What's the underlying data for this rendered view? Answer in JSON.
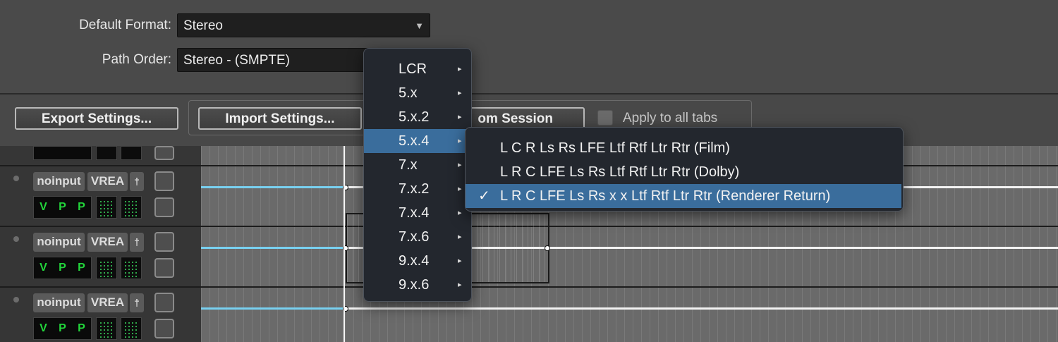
{
  "settings": {
    "default_format_label": "Default Format:",
    "default_format_value": "Stereo",
    "path_order_label": "Path Order:",
    "path_order_value": "Stereo - (SMPTE)"
  },
  "buttons": {
    "export_settings": "Export Settings...",
    "import_settings": "Import Settings...",
    "from_session_visible": "om Session",
    "apply_all_tabs": "Apply to all tabs"
  },
  "tracks": [
    {
      "input": "noinput",
      "output": "VREA",
      "vpp": [
        "V",
        "P",
        "P"
      ]
    },
    {
      "input": "noinput",
      "output": "VREA",
      "vpp": [
        "V",
        "P",
        "P"
      ]
    },
    {
      "input": "noinput",
      "output": "VREA",
      "vpp": [
        "V",
        "P",
        "P"
      ]
    }
  ],
  "format_menu": {
    "items": [
      "LCR",
      "5.x",
      "5.x.2",
      "5.x.4",
      "7.x",
      "7.x.2",
      "7.x.4",
      "7.x.6",
      "9.x.4",
      "9.x.6"
    ],
    "selected": "5.x.4"
  },
  "order_submenu": {
    "items": [
      "L C R Ls Rs LFE Ltf Rtf Ltr Rtr (Film)",
      "L R C LFE Ls Rs Ltf Rtf Ltr Rtr (Dolby)",
      "L R C LFE Ls Rs x x Ltf Rtf Ltr Rtr (Renderer Return)"
    ],
    "checked": "L R C LFE Ls Rs x x Ltf Rtf Ltr Rtr (Renderer Return)",
    "check_glyph": "✓"
  },
  "colors": {
    "highlight": "#3a6d9c",
    "volume_line": "#78d0f0",
    "meter_green": "#22d63b"
  }
}
